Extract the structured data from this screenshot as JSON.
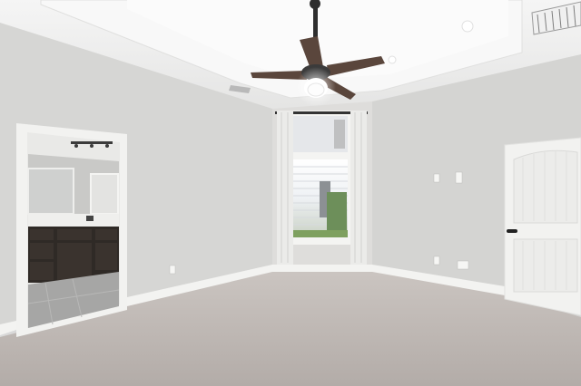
{
  "scene": {
    "subject": "empty-bedroom-interior",
    "colors": {
      "ceiling": "#f1f1f1",
      "tray_ceiling": "#f7f7f7",
      "wall_left": "#d8d8d6",
      "wall_back": "#dedddb",
      "wall_right": "#d6d6d4",
      "carpet": "#bdb6b2",
      "trim": "#f4f4f2",
      "cabinet": "#2f2a26",
      "fan_blade": "#5a463c",
      "door": "#f2f2f0"
    },
    "icons": [
      "ceiling-fan-icon",
      "air-vent-icon",
      "recessed-light-icon",
      "door-handle-icon",
      "outlet-icon",
      "light-switch-icon"
    ]
  }
}
